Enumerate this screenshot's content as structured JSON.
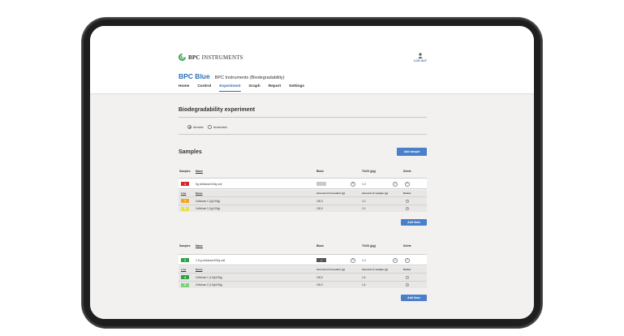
{
  "logo": {
    "brand": "BPC",
    "suffix": "INSTRUMENTS"
  },
  "user": {
    "label": "LOG OUT"
  },
  "app": {
    "title": "BPC Blue",
    "subtitle": "BPC Instruments (Biodegradability)"
  },
  "nav": [
    "Home",
    "Control",
    "Experiment",
    "Graph",
    "Report",
    "Settings"
  ],
  "experiment": {
    "title": "Biodegradability experiment",
    "options": [
      "Aerobic",
      "Anaerobic"
    ],
    "selected": "Aerobic"
  },
  "samples": {
    "title": "Samples",
    "add_button": "Add sample",
    "headers": {
      "samples": "Samples",
      "name": "Name",
      "blank": "Blank",
      "thod": "ThOD (g/g)",
      "delete": "Delete"
    },
    "line_headers": {
      "line": "Line",
      "name": "Name",
      "inoculum": "Amount of inoculum (g)",
      "sample": "Amount of sample (g)",
      "delete": "Delete"
    },
    "add_lines_button": "Add lines",
    "items": [
      {
        "badge": "1",
        "badge_color": "#d7262b",
        "name": "5g cellulose/100g soil",
        "blank": "",
        "blank_color": "#c9c9c9",
        "thod": "1.0",
        "lines": [
          {
            "badge": "7",
            "badge_color": "#f0a623",
            "name": "Cellulose 1 (1g/100g)",
            "inoculum": "100,0",
            "sample": "1,0"
          },
          {
            "badge": "8",
            "badge_color": "#e4e24a",
            "name": "Cellulose 2 (1g/100g)",
            "inoculum": "100,0",
            "sample": "1,0"
          }
        ]
      },
      {
        "badge": "2",
        "badge_color": "#2fa34a",
        "name": "1.5 g cellulose/100g soil",
        "blank": "2",
        "blank_color": "#555555",
        "thod": "1.2",
        "lines": [
          {
            "badge": "4",
            "badge_color": "#2fa34a",
            "name": "Cellulose 1 (1.5g/100g)",
            "inoculum": "100,0",
            "sample": "1,5"
          },
          {
            "badge": "5",
            "badge_color": "#7fd17f",
            "name": "Cellulose 2 (1.5g/100g)",
            "inoculum": "100,0",
            "sample": "1,5"
          }
        ]
      }
    ]
  }
}
